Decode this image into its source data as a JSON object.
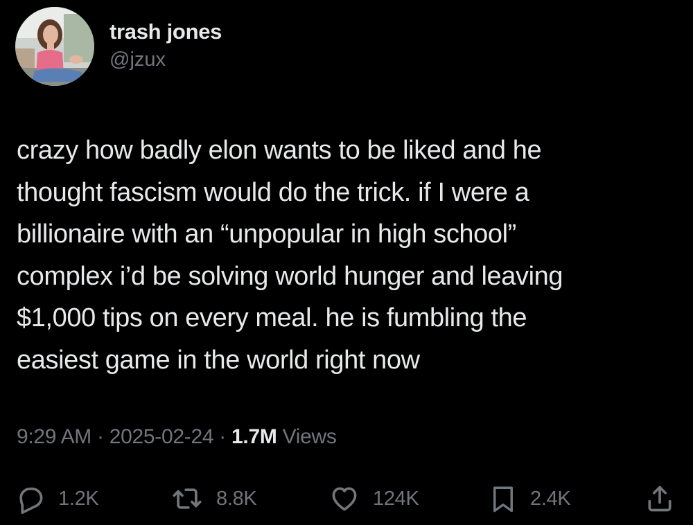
{
  "author": {
    "display_name": "trash jones",
    "handle": "@jzux",
    "avatar_icon": "profile-photo"
  },
  "tweet": {
    "text": "crazy how badly elon wants to be liked and he\nthought fascism would do the trick. if I were a\nbillionaire with an “unpopular in high school”\ncomplex i’d be solving world hunger and leaving\n$1,000 tips on every meal. he is fumbling the\neasiest game in the world right now",
    "time": "9:29 AM",
    "separator": "·",
    "date": "2025-02-24",
    "views_count": "1.7M",
    "views_label": "Views"
  },
  "actions": {
    "reply": {
      "icon": "reply-icon",
      "count": "1.2K"
    },
    "retweet": {
      "icon": "retweet-icon",
      "count": "8.8K"
    },
    "like": {
      "icon": "heart-icon",
      "count": "124K"
    },
    "bookmark": {
      "icon": "bookmark-icon",
      "count": "2.4K"
    },
    "share": {
      "icon": "share-icon"
    }
  },
  "colors": {
    "background": "#000000",
    "primary_text": "#e7e9ea",
    "secondary_text": "#71767b"
  }
}
